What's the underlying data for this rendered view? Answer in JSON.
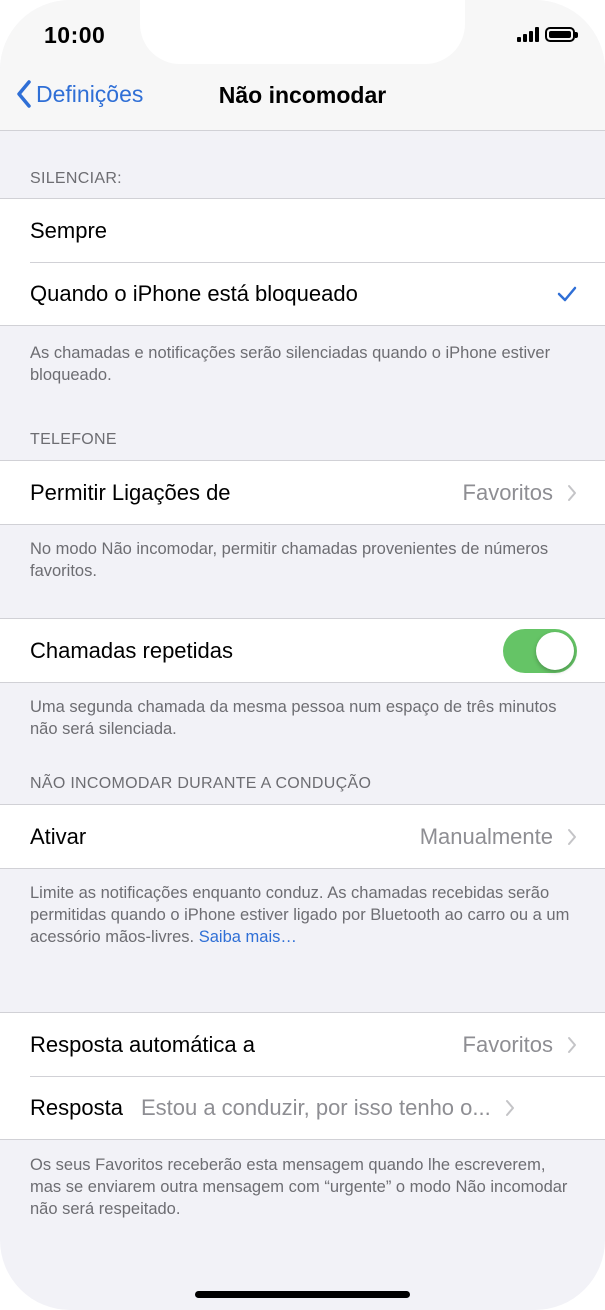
{
  "status_bar": {
    "time": "10:00"
  },
  "nav": {
    "back_label": "Definições",
    "title": "Não incomodar"
  },
  "silence": {
    "header": "SILENCIAR:",
    "options": [
      {
        "label": "Sempre",
        "selected": false
      },
      {
        "label": "Quando o iPhone está bloqueado",
        "selected": true
      }
    ],
    "footer": "As chamadas e notificações serão silenciadas quando o iPhone estiver bloqueado."
  },
  "phone": {
    "header": "TELEFONE",
    "allow_calls_label": "Permitir Ligações de",
    "allow_calls_value": "Favoritos",
    "allow_calls_footer": "No modo Não incomodar, permitir chamadas provenientes de números favoritos.",
    "repeated_calls_label": "Chamadas repetidas",
    "repeated_calls_on": true,
    "repeated_calls_footer": "Uma segunda chamada da mesma pessoa num espaço de três minutos não será silenciada."
  },
  "driving": {
    "header": "NÃO INCOMODAR DURANTE A CONDUÇÃO",
    "activate_label": "Ativar",
    "activate_value": "Manualmente",
    "footer_text": "Limite as notificações enquanto conduz. As chamadas recebidas serão permitidas quando o iPhone estiver ligado por Bluetooth ao carro ou a um acessório mãos-livres.",
    "footer_link": "Saiba mais…"
  },
  "auto_reply": {
    "to_label": "Resposta automática a",
    "to_value": "Favoritos",
    "reply_label": "Resposta",
    "reply_value": "Estou a conduzir, por isso tenho o...",
    "footer": "Os seus Favoritos receberão esta mensagem quando lhe escreverem, mas se enviarem outra mensagem com “urgente” o modo Não incomodar não será respeitado."
  },
  "colors": {
    "accent": "#2f6fd6",
    "toggle_on": "#65c466",
    "secondary_text": "#8e8e93"
  },
  "icons": [
    "chevron-left-icon",
    "checkmark-icon",
    "chevron-right-icon",
    "signal-icon",
    "battery-icon"
  ]
}
